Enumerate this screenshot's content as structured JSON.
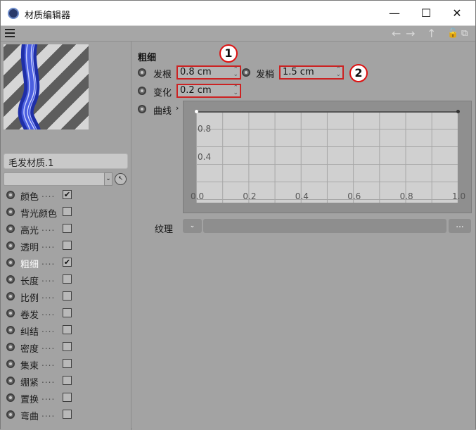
{
  "window": {
    "title": "材质编辑器",
    "minimize": "—",
    "maximize": "☐",
    "close": "✕"
  },
  "toolbar": {
    "back": "←",
    "forward": "→",
    "up": "↑",
    "lock": "🔓",
    "new_window": "⧉"
  },
  "material": {
    "name": "毛发材质.1"
  },
  "channels": [
    {
      "label": "颜色",
      "checked": true,
      "active": false
    },
    {
      "label": "背光颜色",
      "checked": false,
      "active": false
    },
    {
      "label": "高光",
      "checked": false,
      "active": false
    },
    {
      "label": "透明",
      "checked": false,
      "active": false
    },
    {
      "label": "粗细",
      "checked": true,
      "active": true
    },
    {
      "label": "长度",
      "checked": false,
      "active": false
    },
    {
      "label": "比例",
      "checked": false,
      "active": false
    },
    {
      "label": "卷发",
      "checked": false,
      "active": false
    },
    {
      "label": "纠结",
      "checked": false,
      "active": false
    },
    {
      "label": "密度",
      "checked": false,
      "active": false
    },
    {
      "label": "集束",
      "checked": false,
      "active": false
    },
    {
      "label": "绷紧",
      "checked": false,
      "active": false
    },
    {
      "label": "置换",
      "checked": false,
      "active": false
    },
    {
      "label": "弯曲",
      "checked": false,
      "active": false
    }
  ],
  "thickness": {
    "section": "粗细",
    "root_label": "发根",
    "root_value": "0.8 cm",
    "tip_label": "发梢",
    "tip_value": "1.5 cm",
    "variation_label": "变化",
    "variation_value": "0.2 cm",
    "curve_label": "曲线",
    "marker_1": "1",
    "marker_2": "2",
    "curve": {
      "x_ticks": [
        "0.0",
        "0.2",
        "0.4",
        "0.6",
        "0.8",
        "1.0"
      ],
      "y_ticks": [
        "0.8",
        "0.4"
      ],
      "points": [
        {
          "x": 0.0,
          "y": 1.0
        },
        {
          "x": 1.0,
          "y": 1.0
        }
      ]
    },
    "texture_label": "纹理",
    "texture_more": "..."
  },
  "colors": {
    "highlight": "#cc2222",
    "panel": "#a3a3a3",
    "hair_blue": "#3344cc"
  }
}
